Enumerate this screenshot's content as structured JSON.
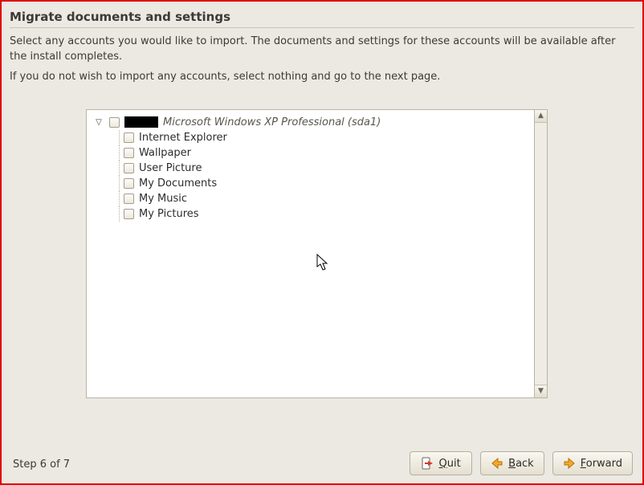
{
  "title": "Migrate documents and settings",
  "intro": {
    "p1": "Select any accounts you would like to import.  The documents and settings for these accounts will be available after the install completes.",
    "p2": "If you do not wish to import any accounts, select nothing and go to the next page."
  },
  "tree": {
    "parent_label": "Microsoft Windows XP Professional (sda1)",
    "children": [
      "Internet Explorer",
      "Wallpaper",
      "User Picture",
      "My Documents",
      "My Music",
      "My Pictures"
    ]
  },
  "footer": {
    "step": "Step 6 of 7",
    "quit": "Quit",
    "back": "Back",
    "forward": "Forward"
  }
}
